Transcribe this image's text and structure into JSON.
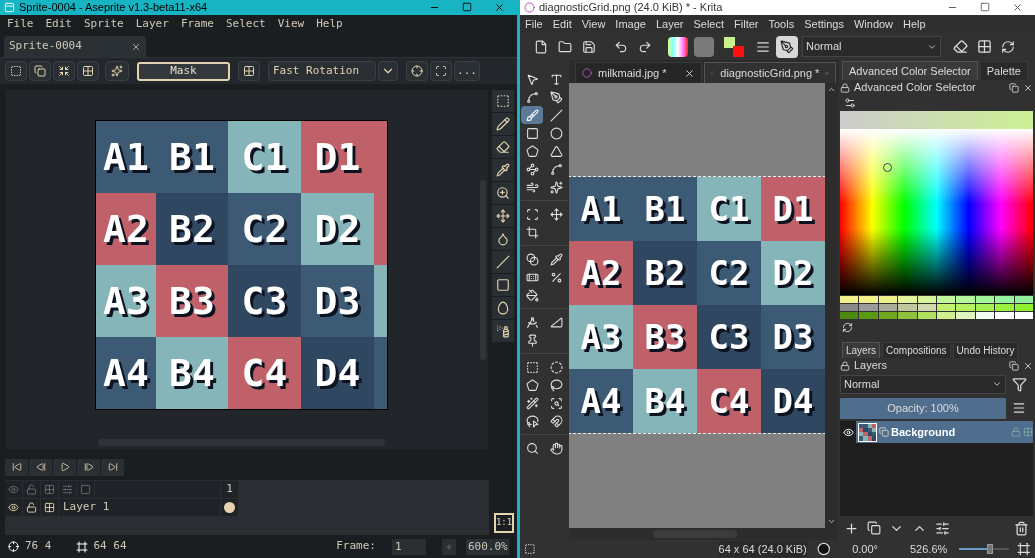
{
  "aseprite": {
    "window": {
      "title": "Sprite-0004 - Aseprite v1.3-beta11-x64"
    },
    "menu": [
      "File",
      "Edit",
      "Sprite",
      "Layer",
      "Frame",
      "Select",
      "View",
      "Help"
    ],
    "tabs": [
      {
        "label": "Sprite-0004",
        "selected": true
      }
    ],
    "toolbar": {
      "mask_button": "Mask",
      "rotation_algorithm": "Fast Rotation",
      "more_button": "..."
    },
    "sprite": {
      "rows": [
        [
          {
            "label": "A1",
            "color": "#3c5a73"
          },
          {
            "label": "B1",
            "color": "#3c5a73"
          },
          {
            "label": "C1",
            "color": "#85b5b8"
          },
          {
            "label": "D1",
            "color": "#c0616a"
          },
          {
            "color": "#c0616a"
          }
        ],
        [
          {
            "label": "A2",
            "color": "#c0616a"
          },
          {
            "label": "B2",
            "color": "#2f4760"
          },
          {
            "label": "C2",
            "color": "#3c5a73"
          },
          {
            "label": "D2",
            "color": "#85b5b8"
          },
          {
            "color": "#c0616a"
          }
        ],
        [
          {
            "label": "A3",
            "color": "#85b5b8"
          },
          {
            "label": "B3",
            "color": "#c0616a"
          },
          {
            "label": "C3",
            "color": "#2f4760"
          },
          {
            "label": "D3",
            "color": "#3c5a73"
          },
          {
            "color": "#85b5b8"
          }
        ],
        [
          {
            "label": "A4",
            "color": "#3c5a73"
          },
          {
            "label": "B4",
            "color": "#85b5b8"
          },
          {
            "label": "C4",
            "color": "#c0616a"
          },
          {
            "label": "D4",
            "color": "#2f4760"
          },
          {
            "color": "#3c5a73"
          }
        ]
      ]
    },
    "timeline": {
      "frames": [
        "1"
      ],
      "layers": [
        {
          "name": "Layer 1"
        }
      ]
    },
    "zoom_button": "1:1",
    "status_bar": {
      "cursor": "76 4",
      "sprite_size": "64 64",
      "frame_label": "Frame:",
      "frame": "1",
      "zoom": "600.0%"
    }
  },
  "krita": {
    "window": {
      "title": "diagnosticGrid.png (24.0 KiB) * - Krita"
    },
    "menu": [
      "File",
      "Edit",
      "View",
      "Image",
      "Layer",
      "Select",
      "Filter",
      "Tools",
      "Settings",
      "Window",
      "Help"
    ],
    "toolbar": {
      "blend_mode": "Normal"
    },
    "tools": [
      {
        "selected": false
      },
      {
        "selected": false
      },
      {
        "selected": false
      },
      {
        "selected": false
      },
      {
        "selected": true
      },
      {
        "selected": false
      },
      {
        "selected": false
      },
      {
        "selected": false
      },
      {
        "selected": false
      },
      {
        "selected": false
      },
      {
        "selected": false
      },
      {
        "selected": false
      },
      {
        "selected": false
      },
      {
        "selected": false
      },
      {
        "selected": false
      },
      {
        "selected": false
      },
      {
        "selected": false
      },
      {
        "selected": false
      },
      {
        "selected": false
      },
      {
        "selected": false
      },
      {
        "selected": false
      },
      {
        "selected": false
      },
      {
        "selected": false
      },
      {
        "selected": false
      },
      {
        "selected": false
      },
      {
        "selected": false
      },
      {
        "selected": false
      },
      {
        "selected": false
      },
      {
        "selected": false
      },
      {
        "selected": false
      },
      {
        "selected": false
      },
      {
        "selected": false
      },
      {
        "selected": false
      },
      {
        "selected": false
      },
      {
        "selected": false
      }
    ],
    "document_tabs": [
      {
        "label": "milkmaid.jpg *",
        "selected": false
      },
      {
        "label": "diagnosticGrid.png *",
        "selected": true
      }
    ],
    "image": {
      "rows": [
        [
          {
            "label": "A1",
            "color": "#3c5a73"
          },
          {
            "label": "B1",
            "color": "#3c5a73"
          },
          {
            "label": "C1",
            "color": "#85b5b8"
          },
          {
            "label": "D1",
            "color": "#c0616a"
          }
        ],
        [
          {
            "label": "A2",
            "color": "#c0616a"
          },
          {
            "label": "B2",
            "color": "#2f4760"
          },
          {
            "label": "C2",
            "color": "#3c5a73"
          },
          {
            "label": "D2",
            "color": "#85b5b8"
          }
        ],
        [
          {
            "label": "A3",
            "color": "#85b5b8"
          },
          {
            "label": "B3",
            "color": "#c0616a"
          },
          {
            "label": "C3",
            "color": "#2f4760"
          },
          {
            "label": "D3",
            "color": "#3c5a73"
          }
        ],
        [
          {
            "label": "A4",
            "color": "#3c5a73"
          },
          {
            "label": "B4",
            "color": "#85b5b8"
          },
          {
            "label": "C4",
            "color": "#c0616a"
          },
          {
            "label": "D4",
            "color": "#2f4760"
          }
        ]
      ]
    },
    "color_docker": {
      "tabs": [
        {
          "label": "Advanced Color Selector",
          "selected": true
        },
        {
          "label": "Palette",
          "selected": false
        }
      ],
      "title": "Advanced Color Selector",
      "swatches": [
        [
          {
            "color": "#f4f08c"
          },
          {
            "color": "#f4f08c"
          },
          {
            "color": "#eef08c"
          },
          {
            "color": "#e6f49a"
          },
          {
            "color": "#d6f49a"
          },
          {
            "color": "#c4f69a"
          },
          {
            "color": "#b4f69a"
          },
          {
            "color": "#a4f69a"
          },
          {
            "color": "#98f49c"
          },
          {
            "color": "#90f0a0"
          }
        ],
        [
          {
            "color": "#8a8a8a"
          },
          {
            "color": "#9a9a9a"
          },
          {
            "color": "#acac9c"
          },
          {
            "color": "#c0c8a0"
          },
          {
            "color": "#d0d8b0"
          },
          {
            "color": "#c4f070"
          },
          {
            "color": "#b4f060"
          },
          {
            "color": "#a4f050"
          },
          {
            "color": "#98f040"
          },
          {
            "color": "#90f030"
          }
        ],
        [
          {
            "color": "#4f8a10"
          },
          {
            "color": "#5a9a10"
          },
          {
            "color": "#70a820"
          },
          {
            "color": "#90c040"
          },
          {
            "color": "#b0e060"
          },
          {
            "color": "#d0f090"
          },
          {
            "color": "#e0f8c0"
          },
          {
            "color": "#f0fff0"
          },
          {
            "color": "#ffffff"
          },
          {
            "color": "#ffffff"
          }
        ]
      ]
    },
    "layers_docker": {
      "tabs": [
        {
          "label": "Layers",
          "selected": true
        },
        {
          "label": "Compositions",
          "selected": false
        },
        {
          "label": "Undo History",
          "selected": false
        }
      ],
      "title": "Layers",
      "blend_mode": "Normal",
      "opacity": {
        "label": "Opacity: 100%",
        "level": 1
      },
      "layers": [
        {
          "name": "Background",
          "selected": true
        }
      ]
    },
    "status_bar": {
      "image_size": "64 x 64 (24.0 KiB)",
      "rotation": "0.00°",
      "zoom": "526.6%",
      "zoom_slider": {
        "level": 0.62
      }
    }
  }
}
